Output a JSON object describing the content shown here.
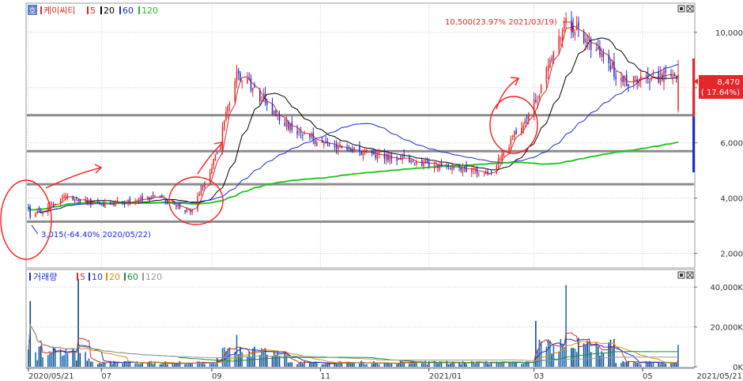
{
  "colors": {
    "up": "#e5262a",
    "down": "#1f2ec9",
    "ma5": "#e0241f",
    "ma20": "#000000",
    "ma60": "#1a2ad1",
    "ma120": "#18c418",
    "vol_ma5": "#d62a2a",
    "vol_ma10": "#2033c8",
    "vol_ma20": "#d99200",
    "vol_ma60": "#1a8a3a",
    "vol_ma120": "#999999",
    "hline": "#8c8c8c",
    "annotation": "#ff1a1a",
    "grid": "#c8c8c8"
  },
  "price_panel": {
    "mode_icon_label": "호",
    "legend": {
      "name": "케이씨티",
      "items": [
        "5",
        "20",
        "60",
        "120"
      ]
    },
    "high_label": "10,500(23.97% 2021/03/19)",
    "low_label": "3,015(-64.40% 2020/05/22)",
    "last_price": "8,470",
    "last_change": "( 17.64%)"
  },
  "volume_panel": {
    "legend": {
      "name": "거래량",
      "items": [
        "5",
        "10",
        "20",
        "60",
        "120"
      ]
    }
  },
  "chart_data": [
    {
      "type": "candlestick",
      "title": "케이씨티",
      "x_range": [
        "2020/05/21",
        "2021/05/21"
      ],
      "x_ticks": [
        "2020/05/21",
        "07",
        "09",
        "11",
        "2021/01",
        "03",
        "05",
        "2021/05/21"
      ],
      "y_ticks": [
        "2,000",
        "4,000",
        "6,000",
        "8,000",
        "10,000"
      ],
      "ylim": [
        1500,
        11000
      ],
      "grid": true,
      "horizontal_levels": [
        7000,
        5700,
        4500,
        3150
      ],
      "series": [
        {
          "name": "5"
        },
        {
          "name": "20"
        },
        {
          "name": "60"
        },
        {
          "name": "120"
        }
      ],
      "price_points": [
        {
          "date": "2020/05/21",
          "close": 3600
        },
        {
          "date": "2020/05/22",
          "close": 3300
        },
        {
          "date": "2020/06/10",
          "close": 4050
        },
        {
          "date": "2020/07/01",
          "close": 3750
        },
        {
          "date": "2020/08/03",
          "close": 4050
        },
        {
          "date": "2020/08/20",
          "close": 3500
        },
        {
          "date": "2020/09/04",
          "close": 5600
        },
        {
          "date": "2020/09/15",
          "close": 8600
        },
        {
          "date": "2020/10/10",
          "close": 6800
        },
        {
          "date": "2020/11/01",
          "close": 6000
        },
        {
          "date": "2020/12/01",
          "close": 5600
        },
        {
          "date": "2021/01/04",
          "close": 5200
        },
        {
          "date": "2021/02/05",
          "close": 4900
        },
        {
          "date": "2021/03/02",
          "close": 7500
        },
        {
          "date": "2021/03/19",
          "close": 10500
        },
        {
          "date": "2021/04/05",
          "close": 9400
        },
        {
          "date": "2021/04/20",
          "close": 8200
        },
        {
          "date": "2021/05/21",
          "close": 8470
        }
      ],
      "annotations": [
        "10,500(23.97% 2021/03/19)",
        "3,015(-64.40% 2020/05/22)"
      ],
      "last": {
        "value": "8,470",
        "change": "( 17.64%)"
      }
    },
    {
      "type": "bar",
      "title": "거래량",
      "y_ticks": [
        "0K",
        "20,000K",
        "40,000K"
      ],
      "ylim": [
        0,
        48000
      ],
      "series": [
        {
          "name": "5"
        },
        {
          "name": "10"
        },
        {
          "name": "20"
        },
        {
          "name": "60"
        },
        {
          "name": "120"
        }
      ],
      "volume_spikes": [
        {
          "date": "2020/05/22",
          "value": 33000
        },
        {
          "date": "2020/06/18",
          "value": 44000
        },
        {
          "date": "2020/09/15",
          "value": 16000
        },
        {
          "date": "2021/03/02",
          "value": 23000
        },
        {
          "date": "2021/03/19",
          "value": 41000
        },
        {
          "date": "2021/05/21",
          "value": 11000
        }
      ]
    }
  ]
}
